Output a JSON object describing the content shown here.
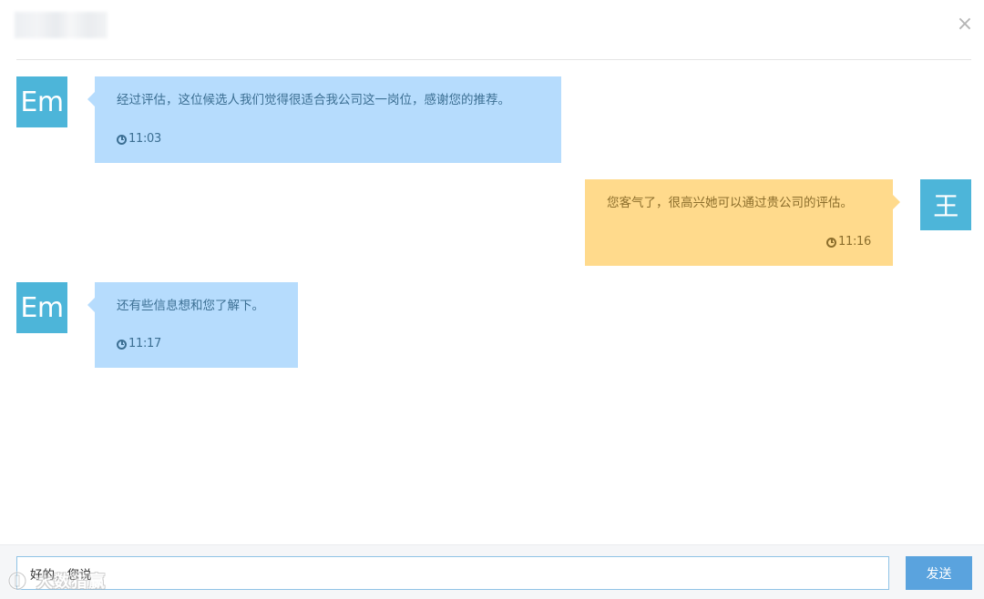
{
  "header": {
    "close_label": "×"
  },
  "messages": [
    {
      "side": "left",
      "avatar": "Em",
      "text": "经过评估，这位候选人我们觉得很适合我公司这一岗位，感谢您的推荐。",
      "time": "11:03"
    },
    {
      "side": "right",
      "avatar": "王",
      "text": "您客气了，很高兴她可以通过贵公司的评估。",
      "time": "11:16"
    },
    {
      "side": "left",
      "avatar": "Em",
      "text": "还有些信息想和您了解下。",
      "time": "11:17"
    }
  ],
  "composer": {
    "value": "好的，您说",
    "send_label": "发送"
  },
  "watermark": {
    "text": "大数猎赢"
  },
  "colors": {
    "avatar_bg": "#4db5d9",
    "left_bubble": "#b6dcfd",
    "right_bubble": "#ffda8c",
    "send_button": "#5aa3de",
    "input_border": "#8fc3e6"
  },
  "icons": {
    "close": "close-icon",
    "time": "clock-icon",
    "watermark": "watermark-logo-icon"
  }
}
